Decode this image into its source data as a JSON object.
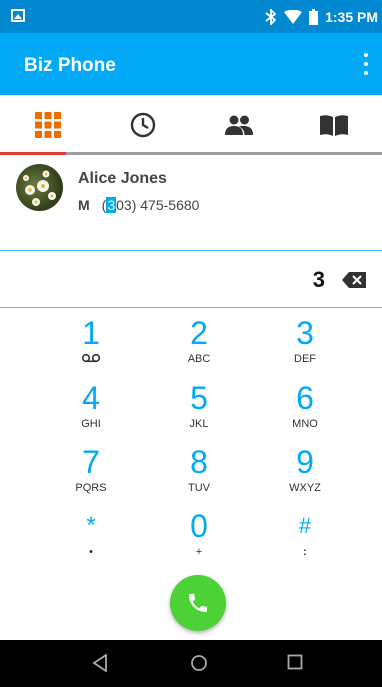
{
  "status_bar": {
    "time": "1:35 PM",
    "icons": [
      "image-icon",
      "bluetooth-icon",
      "wifi-icon",
      "battery-icon"
    ]
  },
  "app_bar": {
    "title": "Biz Phone",
    "menu_icon": "overflow-menu-icon"
  },
  "tabs": [
    {
      "name": "dialpad",
      "icon": "dialpad-icon",
      "active": true
    },
    {
      "name": "recents",
      "icon": "clock-icon",
      "active": false
    },
    {
      "name": "contacts",
      "icon": "people-icon",
      "active": false
    },
    {
      "name": "directory",
      "icon": "book-icon",
      "active": false
    }
  ],
  "contact_match": {
    "name": "Alice Jones",
    "number_type": "M",
    "number_prefix": "(",
    "number_match": "3",
    "number_rest": "03) 475-5680"
  },
  "dialer": {
    "digits": "3"
  },
  "keypad": [
    {
      "digit": "1",
      "sub": "voicemail"
    },
    {
      "digit": "2",
      "sub": "ABC"
    },
    {
      "digit": "3",
      "sub": "DEF"
    },
    {
      "digit": "4",
      "sub": "GHI"
    },
    {
      "digit": "5",
      "sub": "JKL"
    },
    {
      "digit": "6",
      "sub": "MNO"
    },
    {
      "digit": "7",
      "sub": "PQRS"
    },
    {
      "digit": "8",
      "sub": "TUV"
    },
    {
      "digit": "9",
      "sub": "WXYZ"
    },
    {
      "digit": "*",
      "sub": "•"
    },
    {
      "digit": "0",
      "sub": "+"
    },
    {
      "digit": "#",
      "sub": ":"
    }
  ],
  "colors": {
    "status_bar": "#0288d1",
    "app_bar": "#03a9f4",
    "accent": "#03a9f4",
    "tab_active_icon": "#ef6c00",
    "tab_indicator_active": "#e53935",
    "call_button": "#4cd137"
  }
}
